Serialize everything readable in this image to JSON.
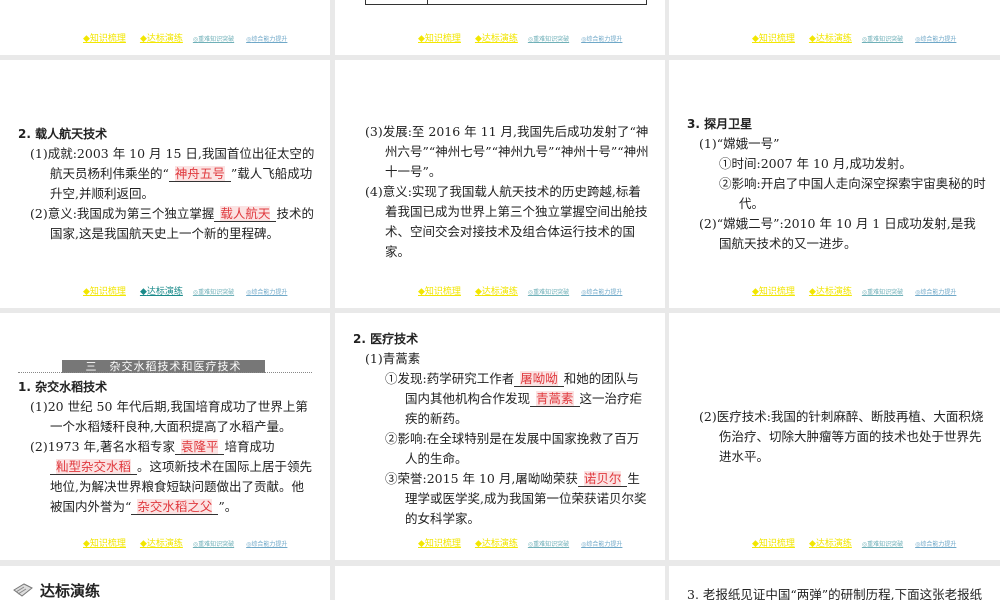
{
  "footer": {
    "items": [
      "知识梳理",
      "达标演练",
      "重难知识突破",
      "综合能力提升"
    ]
  },
  "manned": {
    "heading": "2. 载人航天技术",
    "p1_a": "(1)成就:2003 年 10 月 15 日,我国首位出征太空的航天员杨利伟乘坐的“",
    "p1_blank": "神舟五号",
    "p1_b": "”载人飞船成功升空,并顺利返回。",
    "p2_a": "(2)意义:我国成为第三个独立掌握",
    "p2_blank": "载人航天",
    "p2_b": "技术的国家,这是我国航天史上一个新的里程碑。"
  },
  "manned2": {
    "p3": "(3)发展:至 2016 年 11 月,我国先后成功发射了“神州六号”“神州七号”“神州九号”“神州十号”“神州十一号”。",
    "p4": "(4)意义:实现了我国载人航天技术的历史跨越,标着着我国已成为世界上第三个独立掌握空间出舱技术、空间交会对接技术及组合体运行技术的国家。"
  },
  "lunar": {
    "heading": "3. 探月卫星",
    "p1": "(1)“嫦娥一号”",
    "p1_1": "①时间:2007 年 10 月,成功发射。",
    "p1_2": "②影响:开启了中国人走向深空探索宇宙奥秘的时代。",
    "p2": "(2)“嫦娥二号”:2010 年 10 月 1 日成功发射,是我国航天技术的又一进步。"
  },
  "rice": {
    "banner": "三　杂交水稻技术和医疗技术",
    "heading": "1. 杂交水稻技术",
    "p1": "(1)20 世纪 50 年代后期,我国培育成功了世界上第一个水稻矮秆良种,大面积提高了水稻产量。",
    "p2_a": "(2)1973 年,著名水稻专家",
    "p2_blank1": "袁隆平",
    "p2_b": "培育成功",
    "p2_blank2": "籼型杂交水稻",
    "p2_c": "。这项新技术在国际上居于领先地位,为解决世界粮食短缺问题做出了贡献。他被国内外誉为“",
    "p2_blank3": "杂交水稻之父",
    "p2_d": "”。"
  },
  "medical": {
    "heading": "2. 医疗技术",
    "p1": "(1)青蒿素",
    "i1_a": "①发现:药学研究工作者",
    "i1_blank1": "屠呦呦",
    "i1_b": "和她的团队与国内其他机构合作发现",
    "i1_blank2": "青蒿素",
    "i1_c": "这一治疗疟疾的新药。",
    "i2": "②影响:在全球特别是在发展中国家挽救了百万人的生命。",
    "i3_a": "③荣誉:2015 年 10 月,屠呦呦荣获",
    "i3_blank": "诺贝尔",
    "i3_b": "生理学或医学奖,成为我国第一位荣获诺贝尔奖的女科学家。"
  },
  "medical2": {
    "p2": "(2)医疗技术:我国的针刺麻醉、断肢再植、大面积烧伤治疗、切除大肿瘤等方面的技术也处于世界先进水平。"
  },
  "practice": {
    "heading": "达标演练"
  },
  "question": {
    "text": "3. 老报纸见证中国“两弹”的研制历程,下面这张老报纸"
  }
}
